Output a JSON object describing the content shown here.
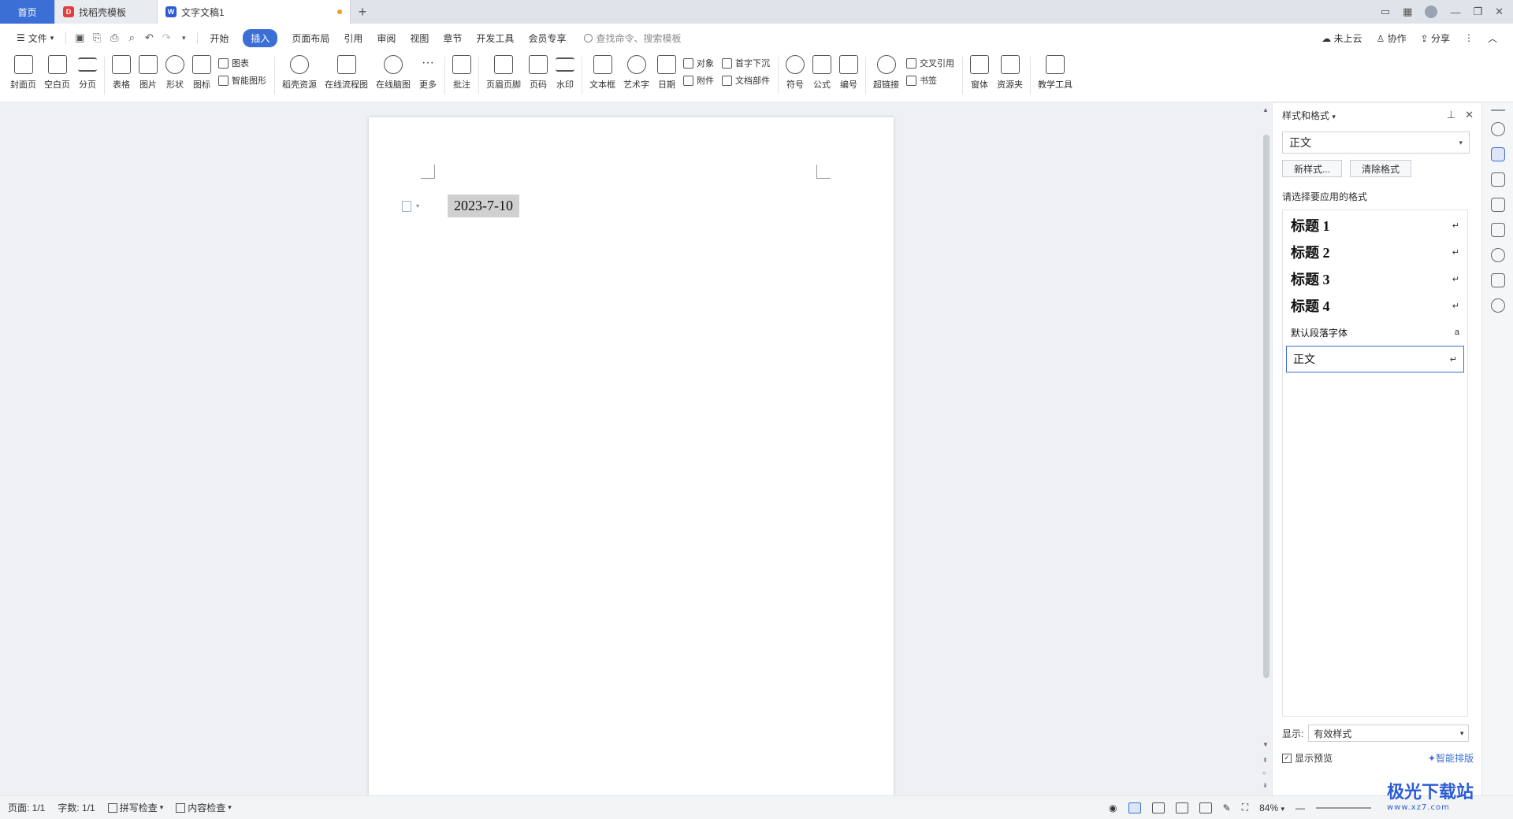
{
  "tabs": [
    {
      "label": "首页"
    },
    {
      "label": "找稻壳模板"
    },
    {
      "label": "文字文稿1"
    }
  ],
  "menu": {
    "file": "文件",
    "items": [
      "开始",
      "插入",
      "页面布局",
      "引用",
      "审阅",
      "视图",
      "章节",
      "开发工具",
      "会员专享"
    ],
    "active": "插入",
    "search_placeholder": "查找命令、搜索模板",
    "cloud": "未上云",
    "collab": "协作",
    "share": "分享"
  },
  "ribbon": {
    "cover": "封面页",
    "blank": "空白页",
    "pagebreak": "分页",
    "table": "表格",
    "picture": "图片",
    "shape": "形状",
    "iconlib": "图标",
    "chart": "图表",
    "smartart": "智能图形",
    "docer": "稻壳资源",
    "flowchart": "在线流程图",
    "mindmap": "在线脑图",
    "more": "更多",
    "comment": "批注",
    "headerfooter": "页眉页脚",
    "pagenum": "页码",
    "watermark": "水印",
    "textbox": "文本框",
    "wordart": "艺术字",
    "date": "日期",
    "object": "对象",
    "attach": "附件",
    "dropcap": "首字下沉",
    "docpart": "文档部件",
    "symbol": "符号",
    "equation": "公式",
    "numbering": "编号",
    "hyperlink": "超链接",
    "crossref": "交叉引用",
    "bookmark": "书签",
    "window": "窗体",
    "resource": "资源夹",
    "teaching": "教学工具"
  },
  "document": {
    "text": "2023-7-10"
  },
  "panel": {
    "title": "样式和格式",
    "current_style": "正文",
    "new_style": "新样式...",
    "clear_format": "清除格式",
    "hint": "请选择要应用的格式",
    "styles": [
      {
        "name": "标题 1",
        "mark": "↵"
      },
      {
        "name": "标题 2",
        "mark": "↵"
      },
      {
        "name": "标题 3",
        "mark": "↵"
      },
      {
        "name": "标题 4",
        "mark": "↵"
      },
      {
        "name": "默认段落字体",
        "mark": "a"
      },
      {
        "name": "正文",
        "mark": "↵"
      }
    ],
    "show_label": "显示:",
    "show_value": "有效样式",
    "preview": "显示预览",
    "smart": "智能排版"
  },
  "status": {
    "page": "页面: 1/1",
    "words": "字数: 1/1",
    "spell": "拼写检查",
    "content": "内容检查",
    "zoom": "84%"
  },
  "watermark_logo": {
    "main": "极光下载站",
    "sub": "www.xz7.com"
  }
}
